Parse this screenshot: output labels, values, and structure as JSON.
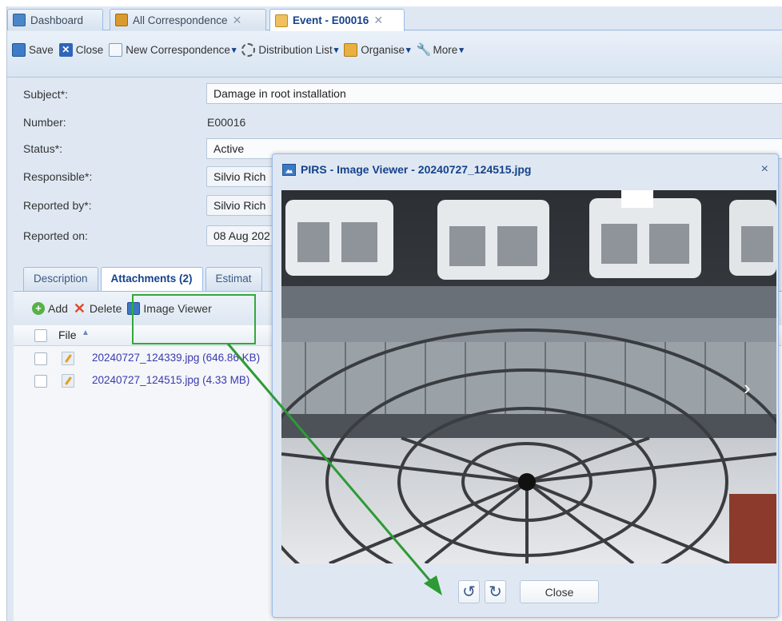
{
  "tabs": [
    {
      "label": "Dashboard",
      "icon": "dashboard-icon",
      "closable": false,
      "active": false
    },
    {
      "label": "All Correspondence",
      "icon": "folder-icon",
      "closable": true,
      "active": false
    },
    {
      "label": "Event - E00016",
      "icon": "event-icon",
      "closable": true,
      "active": true
    }
  ],
  "toolbar": {
    "save": "Save",
    "close": "Close",
    "new_correspondence": "New Correspondence",
    "distribution_list": "Distribution List",
    "organise": "Organise",
    "more": "More"
  },
  "form": {
    "subject_label": "Subject*:",
    "subject_value": "Damage in root installation",
    "number_label": "Number:",
    "number_value": "E00016",
    "status_label": "Status*:",
    "status_value": "Active",
    "responsible_label": "Responsible*:",
    "responsible_value": "Silvio Rich",
    "reported_by_label": "Reported by*:",
    "reported_by_value": "Silvio Rich",
    "reported_on_label": "Reported on:",
    "reported_on_value": "08 Aug 202"
  },
  "subtabs": [
    "Description",
    "Attachments (2)",
    "Estimat"
  ],
  "attachments": {
    "add": "Add",
    "delete": "Delete",
    "image_viewer": "Image Viewer",
    "file_header": "File",
    "files": [
      "20240727_124339.jpg (646.86 KB)",
      "20240727_124515.jpg (4.33 MB)"
    ]
  },
  "dialog": {
    "title": "PIRS - Image Viewer - 20240727_124515.jpg",
    "close_x": "×",
    "rotate_left": "↺",
    "rotate_right": "↻",
    "close_button": "Close",
    "next_arrow": "›"
  },
  "colors": {
    "accent": "#15428b",
    "highlight": "#34a83a",
    "panel_bg": "#dfe8f2"
  }
}
